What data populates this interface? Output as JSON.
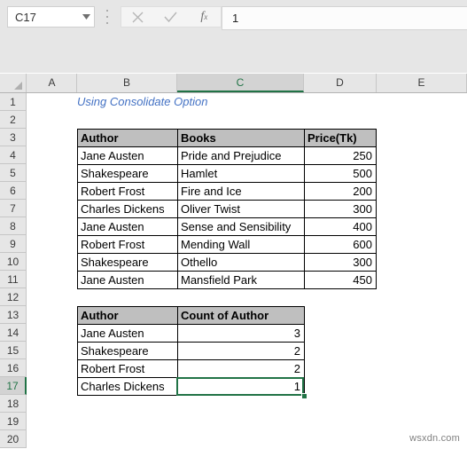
{
  "app": {
    "name_box_value": "C17",
    "formula_bar_value": "1",
    "icons": {
      "dropdown": "chevron-down-icon",
      "cancel": "cancel-x-icon",
      "enter": "confirm-check-icon",
      "function": "fx-insert-function-icon",
      "kebab": "more-options-icon"
    }
  },
  "sheet": {
    "columns": [
      "A",
      "B",
      "C",
      "D",
      "E"
    ],
    "selected_column": "C",
    "selected_row": "17",
    "rows": [
      "1",
      "2",
      "3",
      "4",
      "5",
      "6",
      "7",
      "8",
      "9",
      "10",
      "11",
      "12",
      "13",
      "14",
      "15",
      "16",
      "17",
      "18",
      "19",
      "20"
    ],
    "title_text": "Using Consolidate Option",
    "accent_color": "#217346",
    "title_color": "#4472c4",
    "header_fill": "#bfbfbf"
  },
  "table1": {
    "headers": [
      "Author",
      "Books",
      "Price(Tk)"
    ],
    "rows": [
      [
        "Jane Austen",
        "Pride and Prejudice",
        "250"
      ],
      [
        "Shakespeare",
        "Hamlet",
        "500"
      ],
      [
        "Robert Frost",
        "Fire and Ice",
        "200"
      ],
      [
        "Charles Dickens",
        "Oliver Twist",
        "300"
      ],
      [
        "Jane Austen",
        "Sense and Sensibility",
        "400"
      ],
      [
        "Robert Frost",
        "Mending Wall",
        "600"
      ],
      [
        "Shakespeare",
        "Othello",
        "300"
      ],
      [
        "Jane Austen",
        "Mansfield Park",
        "450"
      ]
    ]
  },
  "table2": {
    "headers": [
      "Author",
      "Count of Author"
    ],
    "rows": [
      [
        "Jane Austen",
        "3"
      ],
      [
        "Shakespeare",
        "2"
      ],
      [
        "Robert Frost",
        "2"
      ],
      [
        "Charles Dickens",
        "1"
      ]
    ]
  },
  "watermark": "wsxdn.com"
}
